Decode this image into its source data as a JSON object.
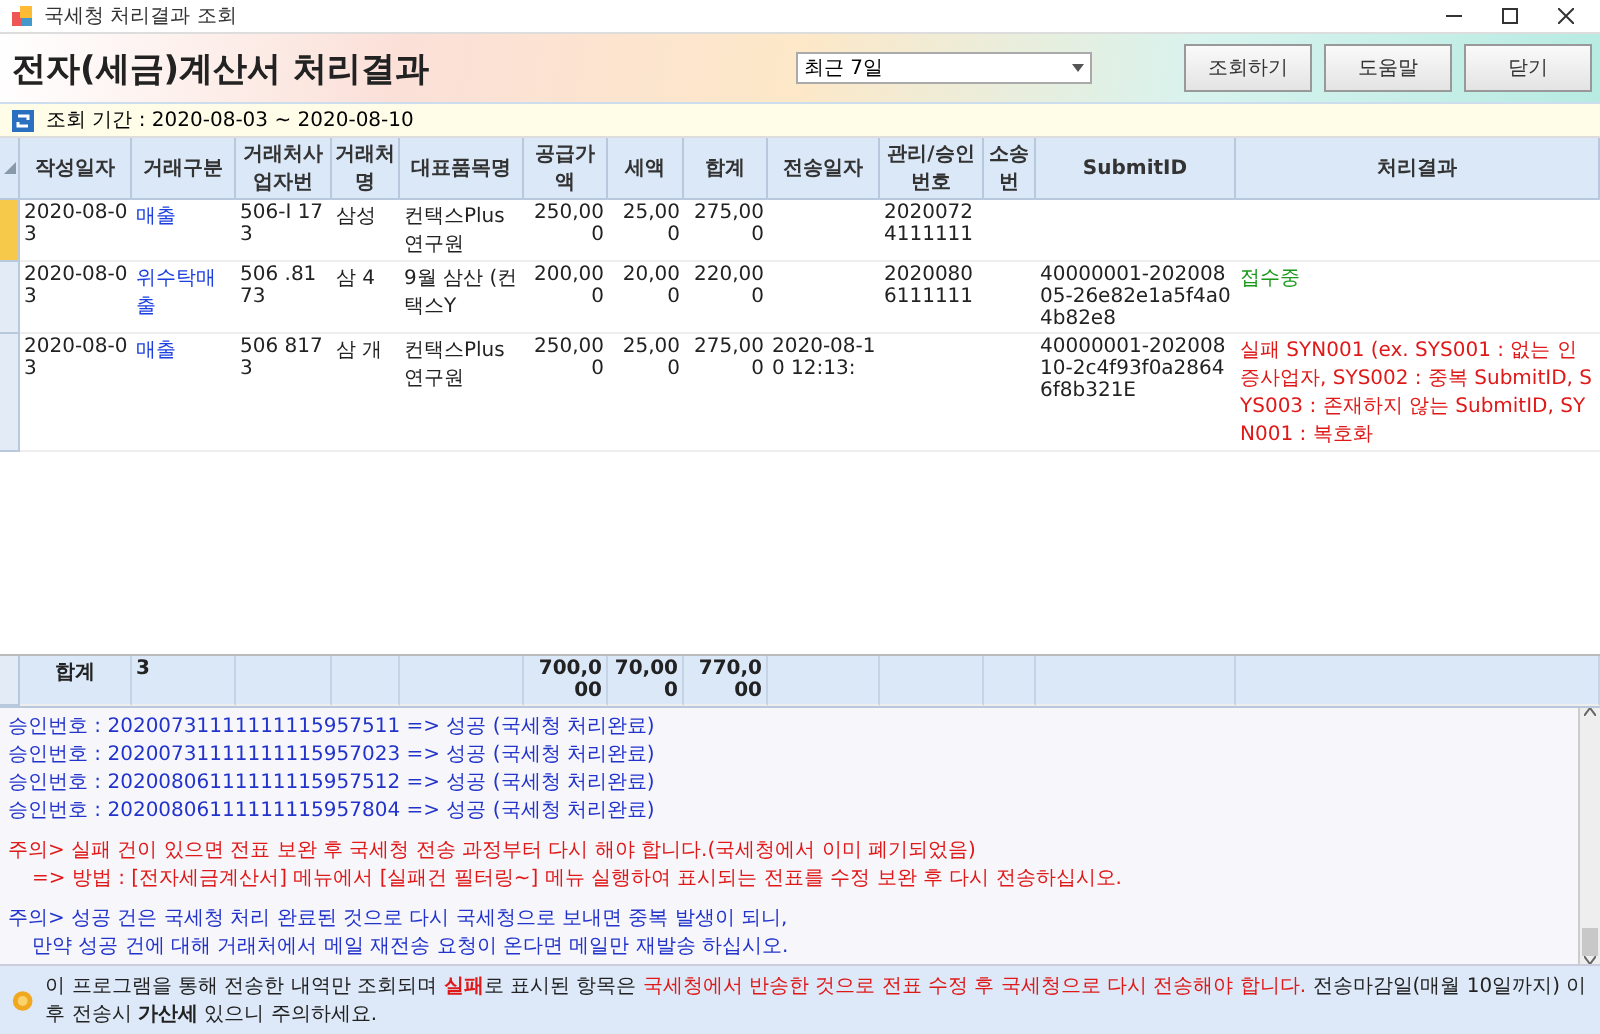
{
  "window": {
    "title": "국세청 처리결과 조회"
  },
  "header": {
    "title": "전자(세금)계산서 처리결과",
    "period": "조회 기간 : 2020-08-03 ~ 2020-08-10",
    "range": {
      "value": "최근 7일"
    },
    "buttons": [
      "조회하기",
      "도움말",
      "닫기"
    ]
  },
  "table": {
    "columns": [
      "작성일자",
      "거래구분",
      "거래처사업자번",
      "거래처명",
      "대표품목명",
      "공급가액",
      "세액",
      "합계",
      "전송일자",
      "관리/승인번호",
      "소송번",
      "SubmitID",
      "처리결과"
    ],
    "rows": [
      {
        "selected": true,
        "cells": [
          "2020-08-03",
          "매출",
          "506-I 173",
          "삼성",
          "컨택스Plus 연구원",
          "250,000",
          "25,000",
          "275,000",
          "",
          "20200724111111",
          "",
          "",
          ""
        ]
      },
      {
        "selected": false,
        "cells": [
          "2020-08-03",
          "위수탁매출",
          "506 .8173",
          "삼 4",
          "9월 삼산 (컨택스Y",
          "200,000",
          "20,000",
          "220,000",
          "",
          "20200806111111",
          "",
          "40000001-20200805-26e82e1a5f4a04b82e8",
          "접수중"
        ],
        "kind": "pending"
      },
      {
        "selected": false,
        "cells": [
          "2020-08-03",
          "매출",
          "506 8173",
          "삼 개",
          "컨택스Plus 연구원",
          "250,000",
          "25,000",
          "275,000",
          "2020-08-10 12:13:",
          "",
          "",
          "40000001-20200810-2c4f93f0a28646f8b321E",
          "실패 SYN001 (ex. SYS001 : 없는 인증사업자, SYS002 : 중복 SubmitID, SYS003 : 존재하지 않는 SubmitID, SYN001 : 복호화"
        ],
        "kind": "failed"
      }
    ],
    "total": {
      "label": "합계",
      "count": "3",
      "supply": "700,000",
      "tax": "70,000",
      "sum": "770,000"
    }
  },
  "log": [
    {
      "kind": "success",
      "lines": [
        "승인번호 : 20200731111111115957511 => 성공 (국세청 처리완료)",
        "승인번호 : 20200731111111115957023 => 성공 (국세청 처리완료)",
        "승인번호 : 20200806111111115957512 => 성공 (국세청 처리완료)",
        "승인번호 : 20200806111111115957804 => 성공 (국세청 처리완료)"
      ]
    },
    {
      "kind": "warning",
      "lines": [
        "주의> 실패 건이 있으면 전표 보완 후 국세청 전송 과정부터 다시 해야 합니다.(국세청에서 이미 폐기되었음)",
        "=> 방법 : [전자세금계산서] 메뉴에서 [실패건 필터링~] 메뉴 실행하여 표시되는 전표를 수정 보완 후 다시 전송하십시오."
      ]
    },
    {
      "kind": "note",
      "lines": [
        "주의> 성공 건은 국세청 처리 완료된 것으로 다시 국세청으로 보내면 중복 발생이 되니,",
        "만약 성공 건에 대해 거래처에서 메일 재전송 요청이 온다면 메일만 재발송 하십시오."
      ]
    }
  ],
  "footer": [
    {
      "kind": "plain",
      "text": "이 프로그램을 통해 전송한 내역만 조회되며 "
    },
    {
      "kind": "alert",
      "text": "실패"
    },
    {
      "kind": "plain",
      "text": "로 표시된 항목은 "
    },
    {
      "kind": "red",
      "text": "국세청에서 반송한 것으로 전표 수정 후 국세청으로 다시 전송해야 합니다."
    },
    {
      "kind": "plain",
      "text": " 전송마감일(매월 10일까지) 이 후 전송시 "
    },
    {
      "kind": "bold",
      "text": "가산세"
    },
    {
      "kind": "plain",
      "text": " 있으니 주의하세요."
    }
  ]
}
